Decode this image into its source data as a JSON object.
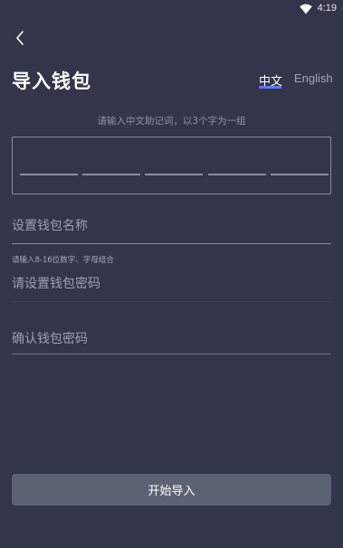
{
  "status_bar": {
    "time": "4:19",
    "wifi_icon": "wifi-icon"
  },
  "header": {
    "back_icon": "chevron-left-icon",
    "title": "导入钱包",
    "lang_tabs": [
      {
        "label": "中文",
        "active": true
      },
      {
        "label": "English",
        "active": false
      }
    ]
  },
  "mnemonic": {
    "hint": "请输入中文助记词，以3个字为一组",
    "slot_count": 5
  },
  "form": {
    "wallet_name_placeholder": "设置钱包名称",
    "password_rule": "请输入8-16位数字、字母组合",
    "password_placeholder": "请设置钱包密码",
    "confirm_password_placeholder": "确认钱包密码"
  },
  "actions": {
    "submit_label": "开始导入"
  },
  "colors": {
    "background": "#33354a",
    "accent": "#5b7cf2",
    "button": "#5d6174"
  }
}
